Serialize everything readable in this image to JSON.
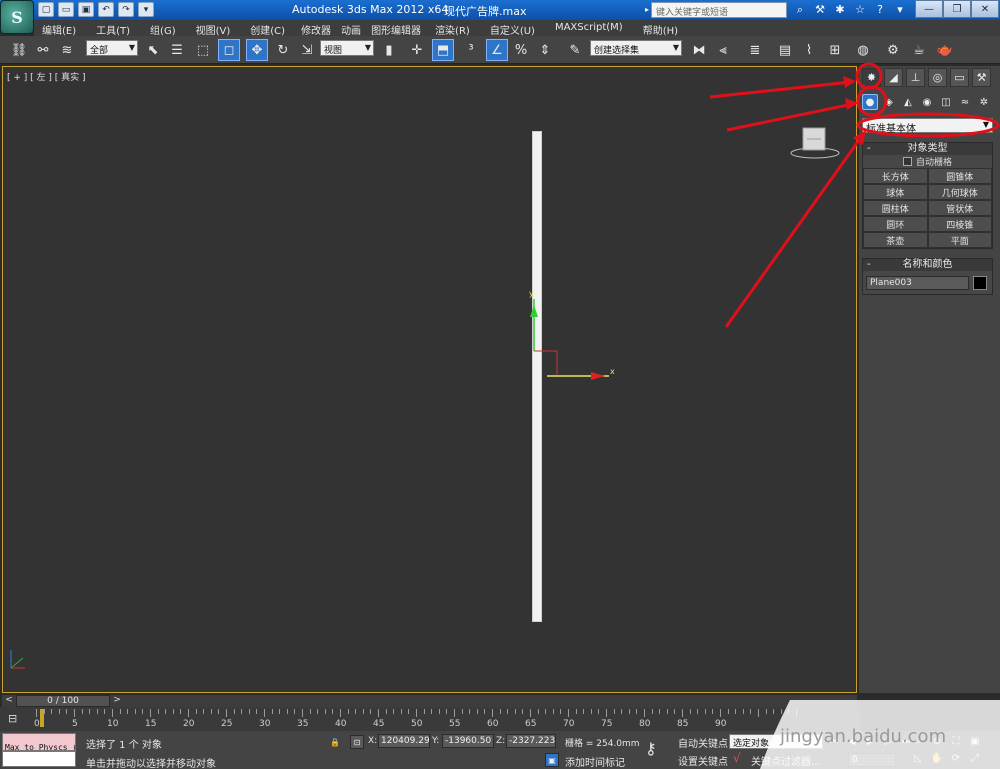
{
  "title": {
    "app": "Autodesk 3ds Max  2012 x64",
    "file": "现代广告牌.max",
    "search_placeholder": "键入关键字或短语"
  },
  "window_controls": {
    "minimize": "—",
    "restore": "❐",
    "close": "✕"
  },
  "menu": [
    {
      "label": "编辑(E)"
    },
    {
      "label": "工具(T)"
    },
    {
      "label": "组(G)"
    },
    {
      "label": "视图(V)"
    },
    {
      "label": "创建(C)"
    },
    {
      "label": "修改器"
    },
    {
      "label": "动画"
    },
    {
      "label": "图形编辑器"
    },
    {
      "label": "渲染(R)"
    },
    {
      "label": "自定义(U)"
    },
    {
      "label": "MAXScript(M)"
    },
    {
      "label": "帮助(H)"
    }
  ],
  "toolbar": {
    "selection_filter": "全部",
    "ref_coord": "视图",
    "named_selection": "创建选择集"
  },
  "viewport": {
    "label": "[ + ] [ 左 ] [ 真实 ]",
    "gizmo_x_label": "x",
    "gizmo_y_label": "y"
  },
  "command_panel": {
    "geometry_type": "标准基本体",
    "object_type_title": "对象类型",
    "autogrid_label": "自动栅格",
    "object_buttons": [
      "长方体",
      "圆锥体",
      "球体",
      "几何球体",
      "圆柱体",
      "管状体",
      "圆环",
      "四棱锥",
      "茶壶",
      "平面"
    ],
    "name_color_title": "名称和颜色",
    "object_name": "Plane003",
    "object_color": "#000000"
  },
  "timeline": {
    "frame_display": "0 / 100",
    "ticks": [
      0,
      5,
      10,
      15,
      20,
      25,
      30,
      35,
      40,
      45,
      50,
      55,
      60,
      65,
      70,
      75,
      80,
      85,
      90
    ]
  },
  "status": {
    "maxscript_text": "Max to Physcs (",
    "selection_info": "选择了 1 个 对象",
    "prompt": "单击并拖动以选择并移动对象",
    "x_label": "X:",
    "x_value": "120409.29",
    "y_label": "Y:",
    "y_value": "-13960.50",
    "z_label": "Z:",
    "z_value": "-2327.223",
    "grid": "栅格 = 254.0mm",
    "add_time_tag": "添加时间标记",
    "auto_key": "自动关键点",
    "set_key": "设置关键点",
    "selected_object": "选定对象",
    "key_filters": "关键点过滤器...",
    "current_frame": "0"
  },
  "watermark": "jingyan.baidu.com",
  "colors": {
    "annotation_red": "#e0101a",
    "viewport_bg": "#333333",
    "panel_bg": "#444444",
    "active_blue": "#2e75c8",
    "selection_border": "#c9a32b"
  }
}
